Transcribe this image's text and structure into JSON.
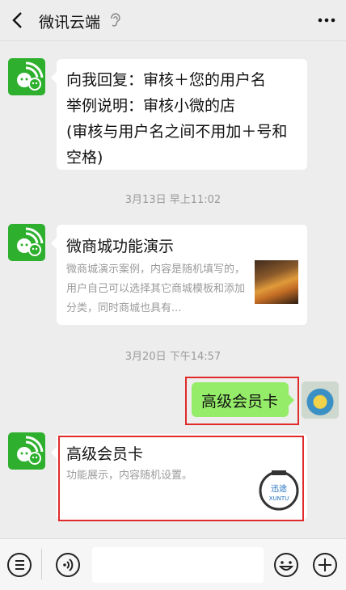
{
  "header": {
    "title": "微讯云端",
    "back_icon": "chevron-left-icon",
    "ear_icon": "ear-icon",
    "more_icon": "more-horizontal-icon"
  },
  "messages": {
    "msg1": {
      "lines": "向我回复：审核＋您的用户名\n举例说明：审核小微的店\n(审核与用户名之间不用加＋号和\n空格)"
    },
    "time1": "3月13日 早上11:02",
    "card1": {
      "title": "微商城功能演示",
      "description": "微商城演示案例，内容是随机填写的，用户自己可以选择其它商城模板和添加分类，同时商城也具有..."
    },
    "time2": "3月20日 下午14:57",
    "sent": {
      "text": "高级会员卡"
    },
    "card2": {
      "title": "高级会员卡",
      "description": "功能展示，内容随机设置。",
      "logo_text": "迅途",
      "logo_subtext": "XUNTU"
    }
  },
  "colors": {
    "accent_green": "#2eb02e",
    "bubble_green": "#95ec69",
    "highlight_red": "#e02a2a"
  },
  "input_bar": {
    "menu_icon": "list-menu-icon",
    "voice_icon": "voice-icon",
    "emoji_icon": "emoji-icon",
    "add_icon": "plus-circle-icon"
  }
}
